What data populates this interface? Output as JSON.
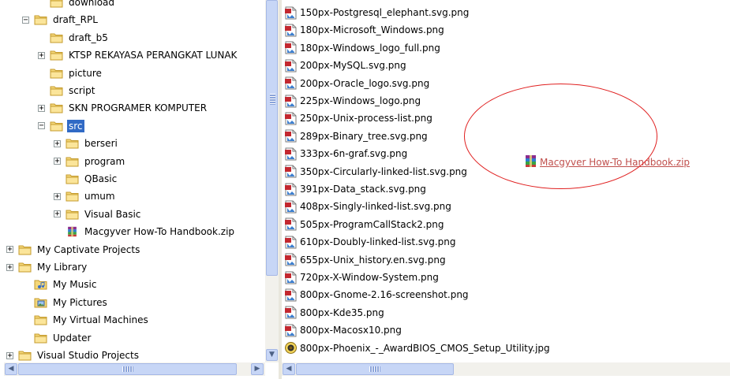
{
  "tree": {
    "items": [
      {
        "label": "download",
        "expander": "",
        "depth": 2,
        "icon": "folder-icon"
      },
      {
        "label": "draft_RPL",
        "expander": "−",
        "depth": 1,
        "icon": "folder-icon"
      },
      {
        "label": "draft_b5",
        "expander": "",
        "depth": 2,
        "icon": "folder-icon"
      },
      {
        "label": "KTSP REKAYASA PERANGKAT LUNAK",
        "expander": "+",
        "depth": 2,
        "icon": "folder-icon"
      },
      {
        "label": "picture",
        "expander": "",
        "depth": 2,
        "icon": "folder-icon"
      },
      {
        "label": "script",
        "expander": "",
        "depth": 2,
        "icon": "folder-icon"
      },
      {
        "label": "SKN PROGRAMER KOMPUTER",
        "expander": "+",
        "depth": 2,
        "icon": "folder-icon"
      },
      {
        "label": "src",
        "expander": "−",
        "depth": 2,
        "icon": "folder-icon",
        "selected": true
      },
      {
        "label": "berseri",
        "expander": "+",
        "depth": 3,
        "icon": "folder-icon"
      },
      {
        "label": "program",
        "expander": "+",
        "depth": 3,
        "icon": "folder-icon"
      },
      {
        "label": "QBasic",
        "expander": "",
        "depth": 3,
        "icon": "folder-icon"
      },
      {
        "label": "umum",
        "expander": "+",
        "depth": 3,
        "icon": "folder-icon"
      },
      {
        "label": "Visual Basic",
        "expander": "+",
        "depth": 3,
        "icon": "folder-icon"
      },
      {
        "label": "Macgyver How-To Handbook.zip",
        "expander": "",
        "depth": 3,
        "icon": "zip-archive-icon"
      },
      {
        "label": "My Captivate Projects",
        "expander": "+",
        "depth": 0,
        "icon": "folder-icon"
      },
      {
        "label": "My Library",
        "expander": "+",
        "depth": 0,
        "icon": "folder-icon"
      },
      {
        "label": "My Music",
        "expander": "",
        "depth": 1,
        "icon": "music-folder-icon"
      },
      {
        "label": "My Pictures",
        "expander": "",
        "depth": 1,
        "icon": "pictures-folder-icon"
      },
      {
        "label": "My Virtual Machines",
        "expander": "",
        "depth": 1,
        "icon": "folder-icon"
      },
      {
        "label": "Updater",
        "expander": "",
        "depth": 1,
        "icon": "folder-icon"
      },
      {
        "label": "Visual Studio Projects",
        "expander": "+",
        "depth": 0,
        "icon": "folder-icon"
      }
    ]
  },
  "files": [
    {
      "name": "150px-Postgresql_elephant.svg.png",
      "icon": "png-image-icon"
    },
    {
      "name": "180px-Microsoft_Windows.png",
      "icon": "png-image-icon"
    },
    {
      "name": "180px-Windows_logo_full.png",
      "icon": "png-image-icon"
    },
    {
      "name": "200px-MySQL.svg.png",
      "icon": "png-image-icon"
    },
    {
      "name": "200px-Oracle_logo.svg.png",
      "icon": "png-image-icon"
    },
    {
      "name": "225px-Windows_logo.png",
      "icon": "png-image-icon"
    },
    {
      "name": "250px-Unix-process-list.png",
      "icon": "png-image-icon"
    },
    {
      "name": "289px-Binary_tree.svg.png",
      "icon": "png-image-icon"
    },
    {
      "name": "333px-6n-graf.svg.png",
      "icon": "png-image-icon"
    },
    {
      "name": "350px-Circularly-linked-list.svg.png",
      "icon": "png-image-icon"
    },
    {
      "name": "391px-Data_stack.svg.png",
      "icon": "png-image-icon"
    },
    {
      "name": "408px-Singly-linked-list.svg.png",
      "icon": "png-image-icon"
    },
    {
      "name": "505px-ProgramCallStack2.png",
      "icon": "png-image-icon"
    },
    {
      "name": "610px-Doubly-linked-list.svg.png",
      "icon": "png-image-icon"
    },
    {
      "name": "655px-Unix_history.en.svg.png",
      "icon": "png-image-icon"
    },
    {
      "name": "720px-X-Window-System.png",
      "icon": "png-image-icon"
    },
    {
      "name": "800px-Gnome-2.16-screenshot.png",
      "icon": "png-image-icon"
    },
    {
      "name": "800px-Kde35.png",
      "icon": "png-image-icon"
    },
    {
      "name": "800px-Macosx10.png",
      "icon": "png-image-icon"
    },
    {
      "name": "800px-Phoenix_-_AwardBIOS_CMOS_Setup_Utility.jpg",
      "icon": "jpg-image-icon"
    }
  ],
  "highlight": {
    "label": "Macgyver How-To Handbook.zip",
    "icon": "zip-archive-icon"
  },
  "colors": {
    "selection": "#316ac5",
    "folder": "#f4d77a",
    "annotation": "#e02020",
    "highlight_text": "#c0504d"
  }
}
